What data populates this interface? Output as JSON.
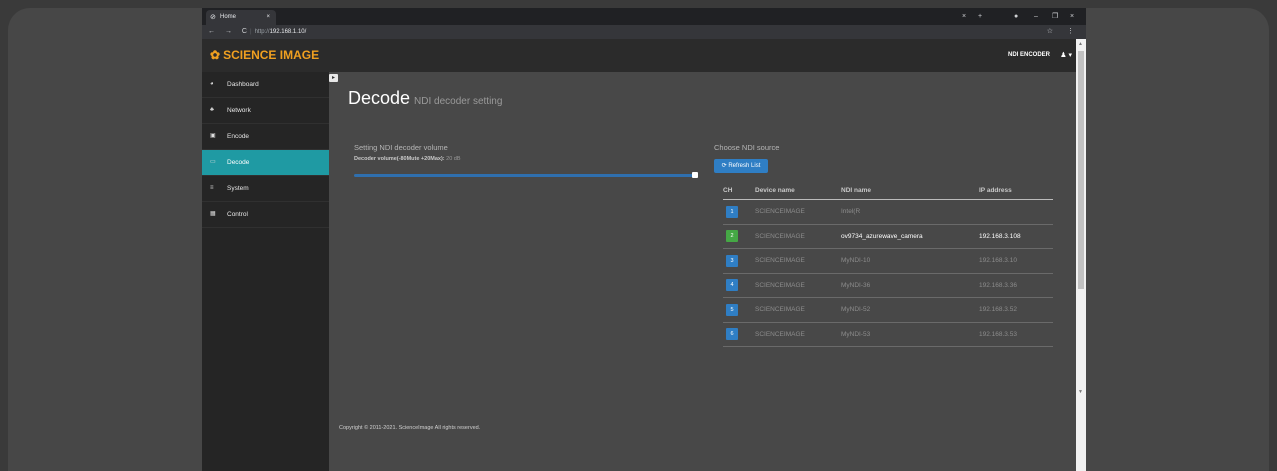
{
  "browser": {
    "tab_title": "Home",
    "tab_close": "×",
    "new_tab": "+",
    "url_prefix": "http://",
    "url_host": "192.168.1.10/",
    "nav": "← → C",
    "right_icons": "☆ ⋮",
    "win_close_left": "×",
    "win_min": "–",
    "win_max": "❐",
    "win_close": "×"
  },
  "header": {
    "brand": "SCIENCE IMAGE",
    "device": "NDI ENCODER",
    "user_icon": "user-icon"
  },
  "sidebar": {
    "items": [
      {
        "label": "Dashboard",
        "icon": "dashboard-icon",
        "active": false
      },
      {
        "label": "Network",
        "icon": "network-icon",
        "active": false
      },
      {
        "label": "Encode",
        "icon": "image-icon",
        "active": false
      },
      {
        "label": "Decode",
        "icon": "monitor-icon",
        "active": true
      },
      {
        "label": "System",
        "icon": "list-icon",
        "active": false
      },
      {
        "label": "Control",
        "icon": "grid-icon",
        "active": false
      }
    ]
  },
  "main": {
    "title": "Decode",
    "subtitle": "NDI decoder setting",
    "volume": {
      "heading": "Setting NDI decoder volume",
      "label": "Decoder volume(-80Mute +20Max):",
      "value": "20 dB",
      "level_fraction": 1.0
    },
    "ndi": {
      "heading": "Choose NDI source",
      "refresh_label": "Refresh List",
      "columns": [
        "CH",
        "Device name",
        "NDI name",
        "IP address"
      ],
      "rows": [
        {
          "ch": "1",
          "device": "SCIENCEIMAGE",
          "ndi": "Intel(R",
          "ip": "",
          "selected": false
        },
        {
          "ch": "2",
          "device": "SCIENCEIMAGE",
          "ndi": "ov9734_azurewave_camera",
          "ip": "192.168.3.108",
          "selected": true
        },
        {
          "ch": "3",
          "device": "SCIENCEIMAGE",
          "ndi": "MyNDI-10",
          "ip": "192.168.3.10",
          "selected": false
        },
        {
          "ch": "4",
          "device": "SCIENCEIMAGE",
          "ndi": "MyNDI-36",
          "ip": "192.168.3.36",
          "selected": false
        },
        {
          "ch": "5",
          "device": "SCIENCEIMAGE",
          "ndi": "MyNDI-52",
          "ip": "192.168.3.52",
          "selected": false
        },
        {
          "ch": "6",
          "device": "SCIENCEIMAGE",
          "ndi": "MyNDI-53",
          "ip": "192.168.3.53",
          "selected": false
        }
      ]
    },
    "copyright": "Copyright © 2011-2021. ScienceImage All rights reserved."
  },
  "colors": {
    "brand": "#f0a020",
    "active_nav": "#1f9aa3",
    "primary_button": "#2f7ec4",
    "selected_channel": "#45a845"
  }
}
